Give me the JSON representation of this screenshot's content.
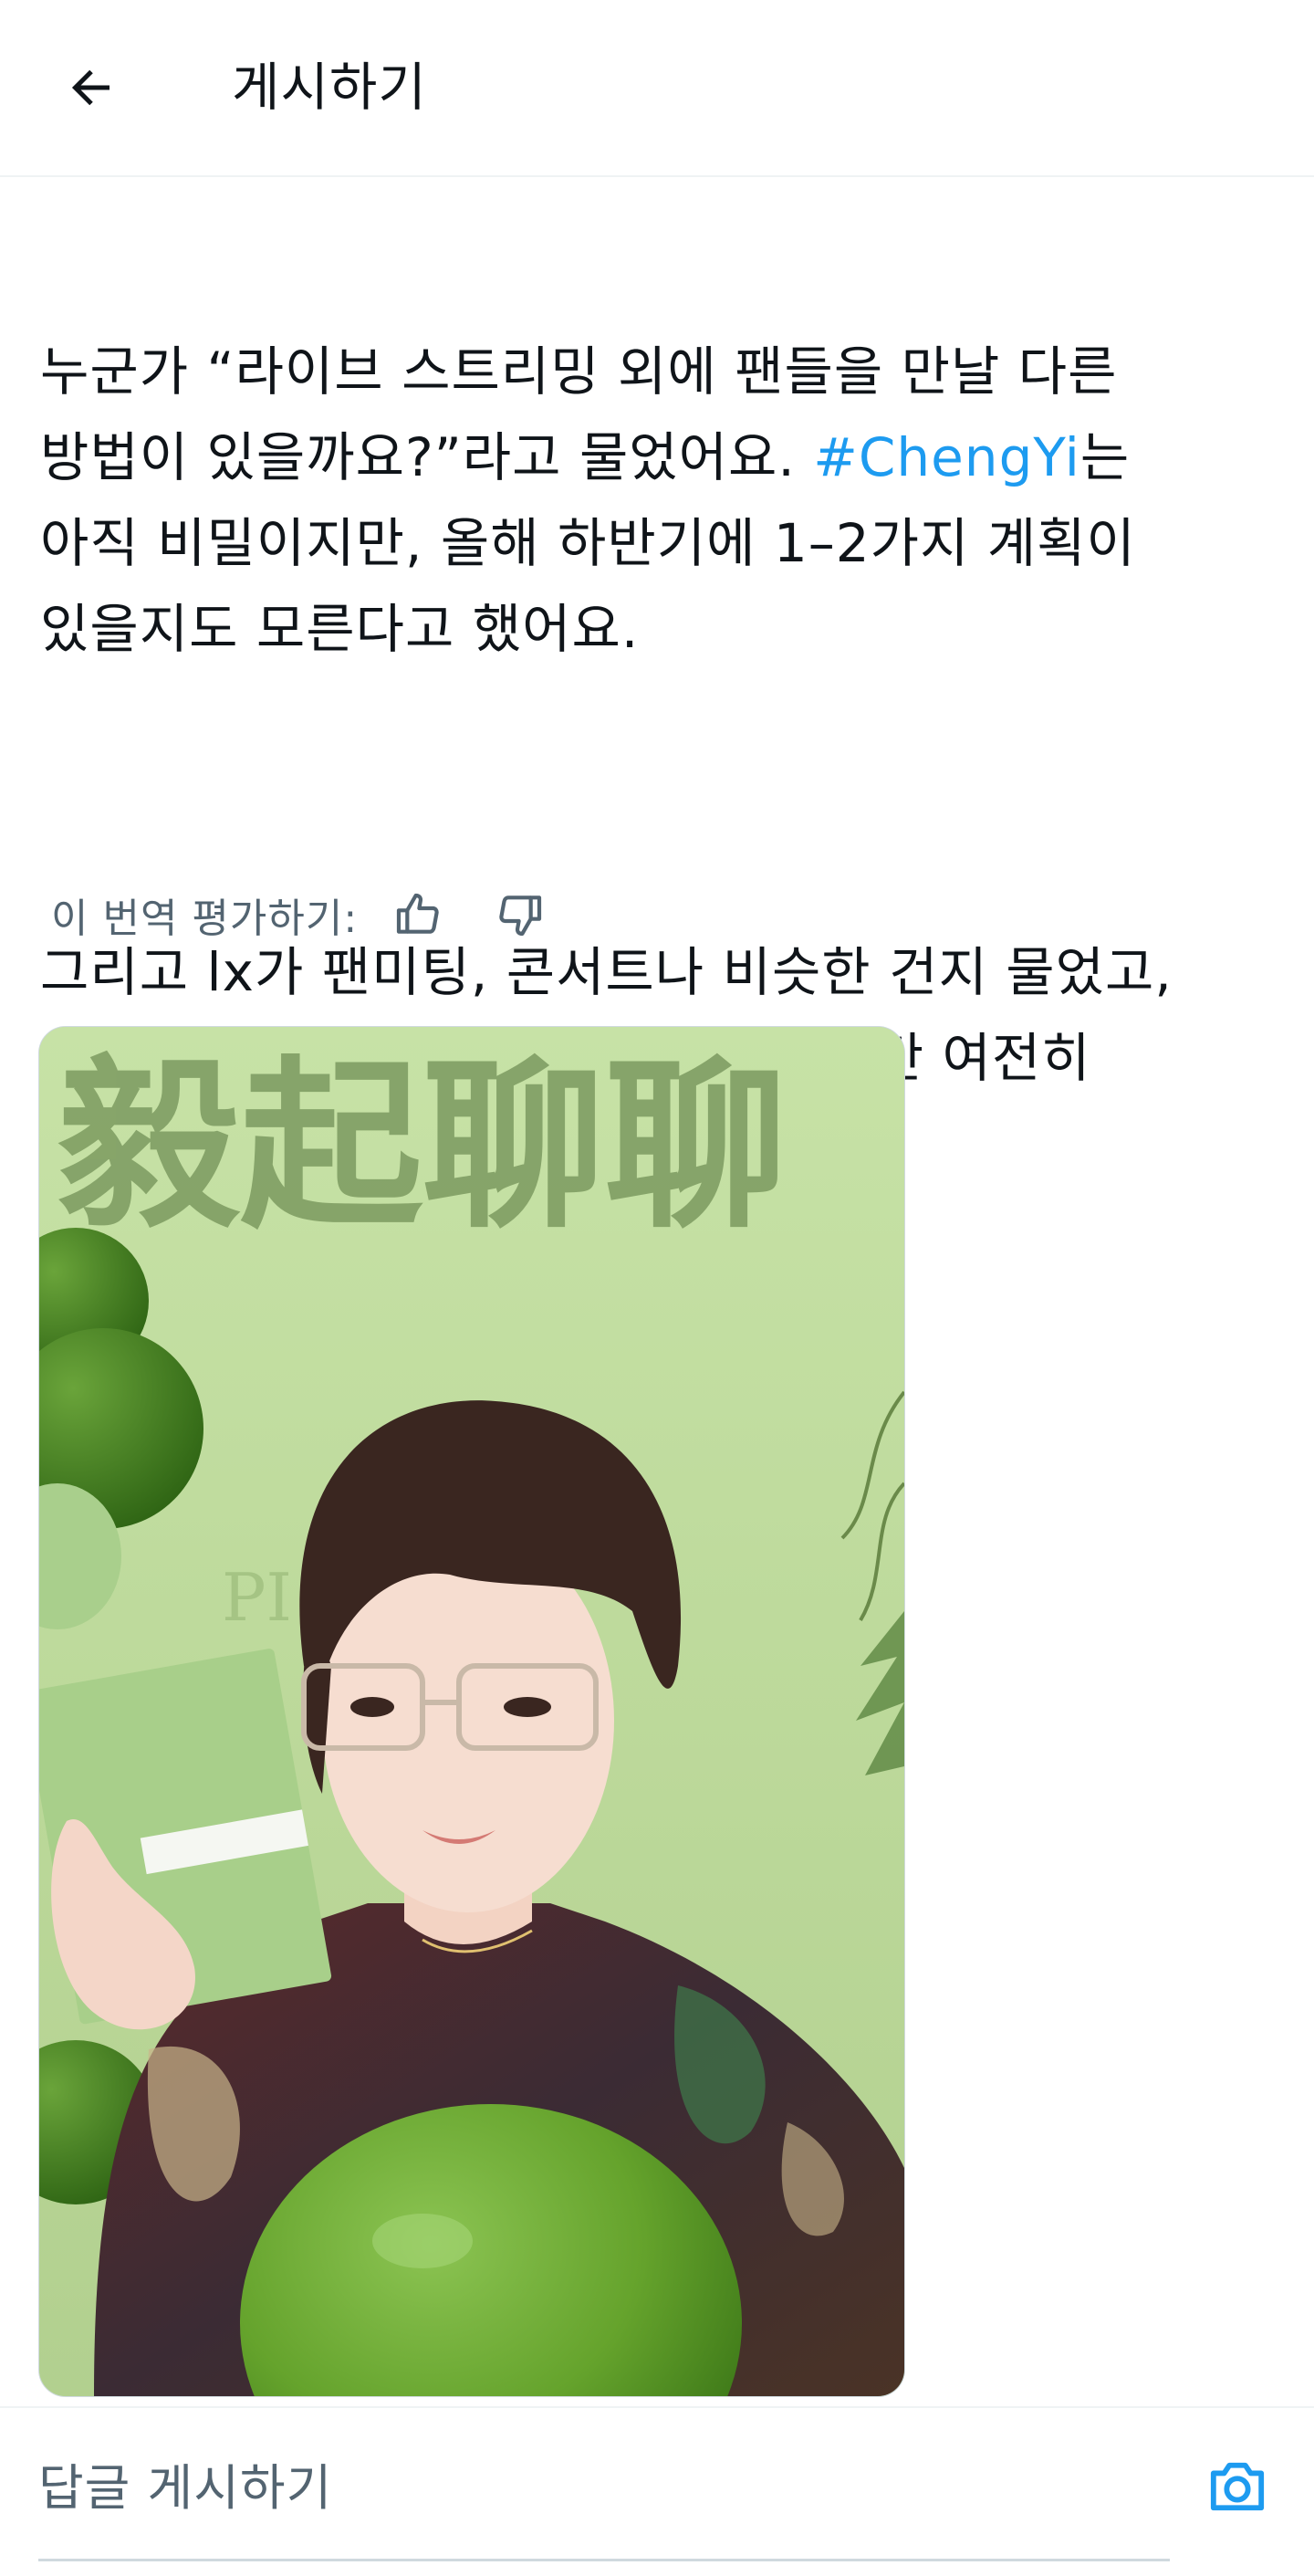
{
  "header": {
    "title": "게시하기"
  },
  "tweet": {
    "paragraph1": {
      "before_hashtag": "누군가 “라이브 스트리밍 외에 팬들을 만날 다른\n방법이 있을까요?”라고 물었어요. ",
      "hashtag": "#ChengYi",
      "after_hashtag": "는\n아직 비밀이지만, 올해 하반기에 1–2가지 계획이\n있을지도 모른다고 했어요."
    },
    "paragraph2": "그리고 lx가 팬미팅, 콘서트나 비슷한 건지 물었고,\ncy는 “가능할 수도 있어요”라고 했지만 여전히\n비밀이래요."
  },
  "translation": {
    "rate_label": "이 번역 평가하기:"
  },
  "media": {
    "banner_text": "毅起聊聊",
    "background_text": "PI        DAY",
    "colors": {
      "background": "#bedb9e",
      "balloon": "#6da33a",
      "banner": "#7c9a60"
    }
  },
  "reply": {
    "placeholder": "답글 게시하기"
  },
  "colors": {
    "accent": "#1d9bf0",
    "text": "#0f1419",
    "secondary": "#536471"
  }
}
